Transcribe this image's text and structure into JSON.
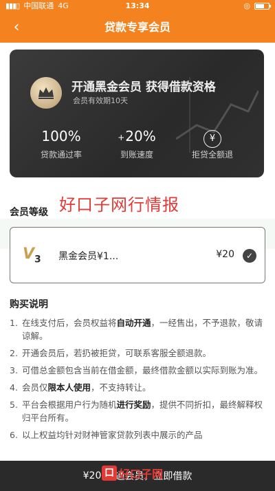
{
  "status_bar": {
    "carrier": "中国联通",
    "network": "4G",
    "time": "13:34"
  },
  "nav": {
    "back_icon": "chevron-left-icon",
    "title": "贷款专享会员"
  },
  "card": {
    "headline": "开通黑金会员  获得借款资格",
    "subtitle": "会员有效期10天",
    "stats": [
      {
        "prefix": "",
        "value": "100%",
        "label": "贷款通过率"
      },
      {
        "prefix": "+",
        "value": "20%",
        "label": "到账速度"
      },
      {
        "icon": "yen-refund-icon",
        "label": "拒贷全额退"
      }
    ]
  },
  "watermark": {
    "text": "好口子网行情报",
    "logo_text": "好口子网",
    "color": "#e53935"
  },
  "membership": {
    "section_title": "会员等级",
    "level_badge": "V",
    "level_badge_sub": "3",
    "level_name": "黑金会员¥1...",
    "price": "¥20",
    "selected": true
  },
  "instructions": {
    "title": "购买说明",
    "items": [
      {
        "num": "1.",
        "pre": "在线支付后，会员权益将",
        "bold": "自动开通",
        "post": "，一经售出，不予退款，敬请谅解。"
      },
      {
        "num": "2.",
        "pre": "开通会员后，若扔被拒贷，可联系客服全额退款。",
        "bold": "",
        "post": ""
      },
      {
        "num": "3.",
        "pre": "可借总金额包含当前在借金额，最终借款金额以实际到账为准。",
        "bold": "",
        "post": ""
      },
      {
        "num": "4.",
        "pre": "会员仅",
        "bold": "限本人使用",
        "post": "，不支持转让。"
      },
      {
        "num": "5.",
        "pre": "平台会根据用户行为随机",
        "bold": "进行奖励",
        "post": "，提供不同折扣，最终解释权归平台所有。"
      },
      {
        "num": "6.",
        "pre": "以上权益均针对财神管家贷款列表中展示的产品",
        "bold": "",
        "post": ""
      }
    ]
  },
  "bottom_bar": {
    "price": "¥20",
    "label": "开通会员，立即借款"
  },
  "colors": {
    "accent": "#f4821e",
    "card_bg": "#2f2f2f",
    "gold": "#c8a250",
    "bottom_bar": "#2a2a2a"
  }
}
